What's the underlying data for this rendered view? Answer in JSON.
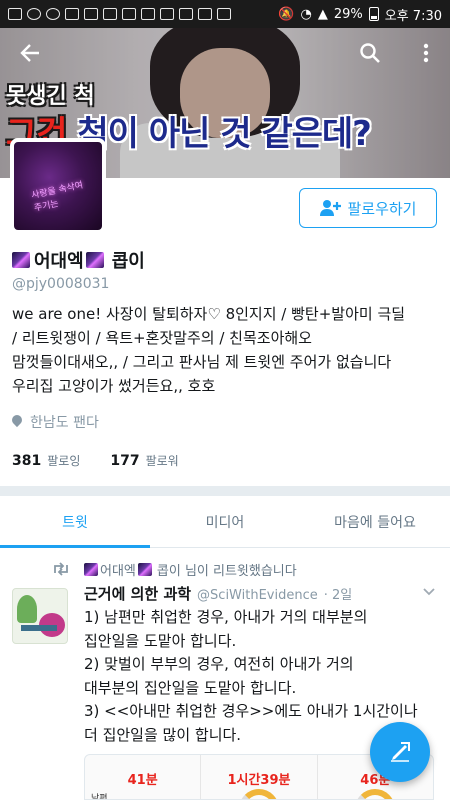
{
  "status_bar": {
    "battery": "29%",
    "time": "오후 7:30"
  },
  "header": {
    "caption_top": "못생긴 척",
    "caption_main_red": "그건",
    "caption_main_rest": "척이 아닌 것 같은데?",
    "back_icon": "arrow-left-icon",
    "search_icon": "search-icon",
    "more_icon": "more-vertical-icon"
  },
  "avatar": {
    "text": "사랑을 속삭여 주기는"
  },
  "follow_button": {
    "label": "팔로우하기",
    "icon": "add-person-icon"
  },
  "profile": {
    "name_prefix": "어대엑",
    "name_suffix": "콥이",
    "handle": "@pjy0008031",
    "bio_lines": [
      "we are one! 사장이 탈퇴하자♡ 8인지지 / 빵탄+발아미 극딜",
      "/ 리트윗쟁이 / 욕트+혼잣말주의 / 친목조아해오",
      "맘껏들이대새오,, / 그리고 판사님 제 트윗엔 주어가 없습니다",
      "우리집 고양이가 썼거든요,, 호호"
    ],
    "location": "한남도 팬다",
    "following_count": "381",
    "following_label": "팔로잉",
    "followers_count": "177",
    "followers_label": "팔로워"
  },
  "tabs": [
    {
      "label": "트윗",
      "active": true
    },
    {
      "label": "미디어",
      "active": false
    },
    {
      "label": "마음에 들어요",
      "active": false
    }
  ],
  "tweet": {
    "retweet_prefix": "어대엑",
    "retweet_suffix": "콥이 님이 리트윗했습니다",
    "author_name": "근거에 의한 과학",
    "author_handle": "@SciWithEvidence",
    "time": "· 2일",
    "body_lines": [
      "1) 남편만 취업한 경우, 아내가 거의 대부분의",
      "집안일을 도맡아 합니다.",
      "2) 맞벌이 부부의 경우, 여전히 아내가 거의",
      "대부분의 집안일을 도맡아 합니다.",
      "3) <<아내만 취업한 경우>>에도 아내가 1시간이나",
      "더 집안일을 많이 합니다."
    ],
    "image": {
      "cells": [
        {
          "value": "41분",
          "label": "남편"
        },
        {
          "value": "1시간39분",
          "label": ""
        },
        {
          "value": "46분",
          "label": ""
        }
      ]
    }
  },
  "compose_fab": {
    "icon": "compose-icon"
  },
  "colors": {
    "accent": "#1da1f2",
    "caption_red": "#e8241d",
    "caption_blue": "#1d2a8c"
  }
}
